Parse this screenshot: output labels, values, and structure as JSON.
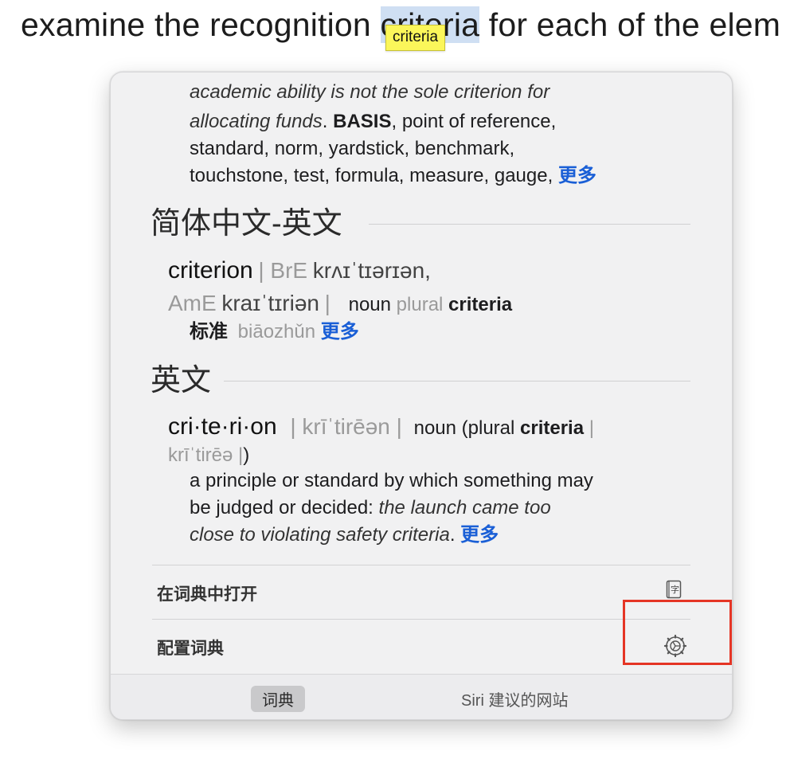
{
  "background": {
    "before": "examine the recognition ",
    "highlight": "criteria",
    "after": " for each of the elem"
  },
  "tooltip": {
    "text": "criteria"
  },
  "thesaurus": {
    "example_line1": "academic ability is not the sole criterion for",
    "example_line2": "allocating funds",
    "after_example": ". ",
    "basis": "BASIS",
    "syn_line1_rest": ", point of reference,",
    "syn_line2": "standard, norm, yardstick, benchmark,",
    "syn_line3": "touchstone, test, formula, measure, gauge,",
    "more": "更多"
  },
  "zh_section": {
    "title": "简体中文-英文",
    "headword": "criterion",
    "pron_bre": "| BrE",
    "ipa_bre": "krʌɪˈtɪərɪən,",
    "pron_ame": "AmE",
    "ipa_ame": "kraɪˈtɪriən",
    "bar": "|",
    "pos": "noun",
    "plural_label": "plural",
    "plural_form": "criteria",
    "translation": "标准",
    "pinyin": "biāozhǔn",
    "more": "更多"
  },
  "en_section": {
    "title": "英文",
    "headword": "cri·te·ri·on",
    "pron": "| krīˈtirēən |",
    "pos_open": "noun (plural",
    "plural_form": "criteria",
    "pron2_a": "|",
    "pron2_b": "krīˈtirēə |",
    "close": ")",
    "def_line1": "a principle or standard by which something may",
    "def_line2": "be judged or decided:",
    "def_example1": "the launch came too",
    "def_example2": "close to violating safety criteria",
    "period": ".",
    "more": "更多"
  },
  "actions": {
    "open_in_dictionary": "在词典中打开",
    "configure_dictionary": "配置词典"
  },
  "footer": {
    "tab_dictionary": "词典",
    "tab_siri": "Siri 建议的网站"
  },
  "colors": {
    "link": "#1a5fd6",
    "highlight": "#cfdff3",
    "tooltip_bg": "#fbf65a",
    "annotation_box": "#e53525"
  },
  "icons": {
    "open_dictionary": "dictionary-book-icon",
    "configure": "gear-icon"
  }
}
